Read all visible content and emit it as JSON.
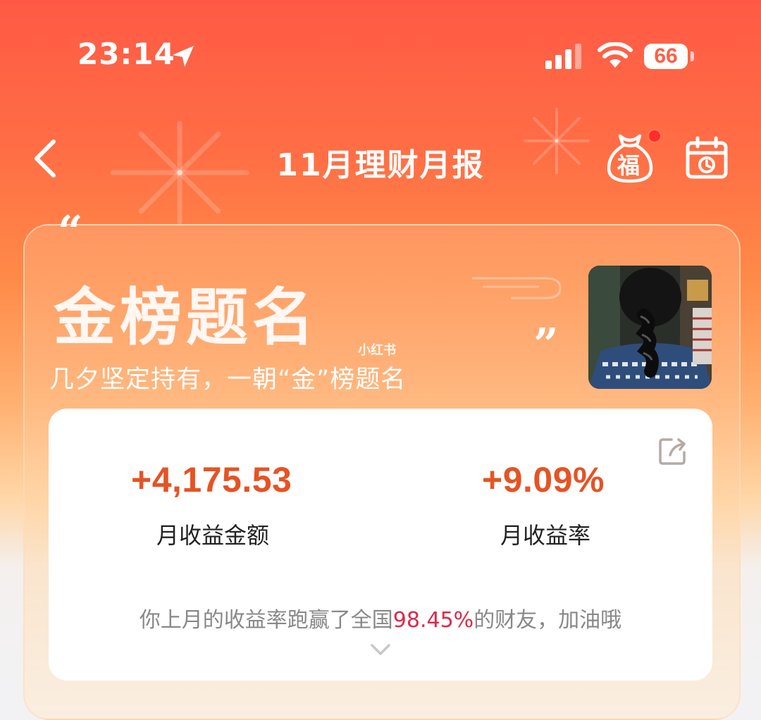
{
  "status_bar": {
    "time": "23:14",
    "battery": "66"
  },
  "nav": {
    "title": "11月理财月报",
    "fu_badge": "福"
  },
  "banner": {
    "quote_open": "“",
    "quote_close": "”",
    "headline": "金榜题名",
    "subline": "几夕坚定持有，一朝“金”榜题名",
    "watermark": "小红书"
  },
  "stats": {
    "amount_value": "+4,175.53",
    "amount_label": "月收益金额",
    "rate_value": "+9.09%",
    "rate_label": "月收益率",
    "rank_prefix": "你上月的收益率跑赢了全国",
    "rank_percent": "98.45%",
    "rank_suffix": "的财友，加油哦"
  },
  "colors": {
    "accent": "#e65324",
    "highlight": "#e0284a",
    "header_top": "#ff5a45"
  }
}
